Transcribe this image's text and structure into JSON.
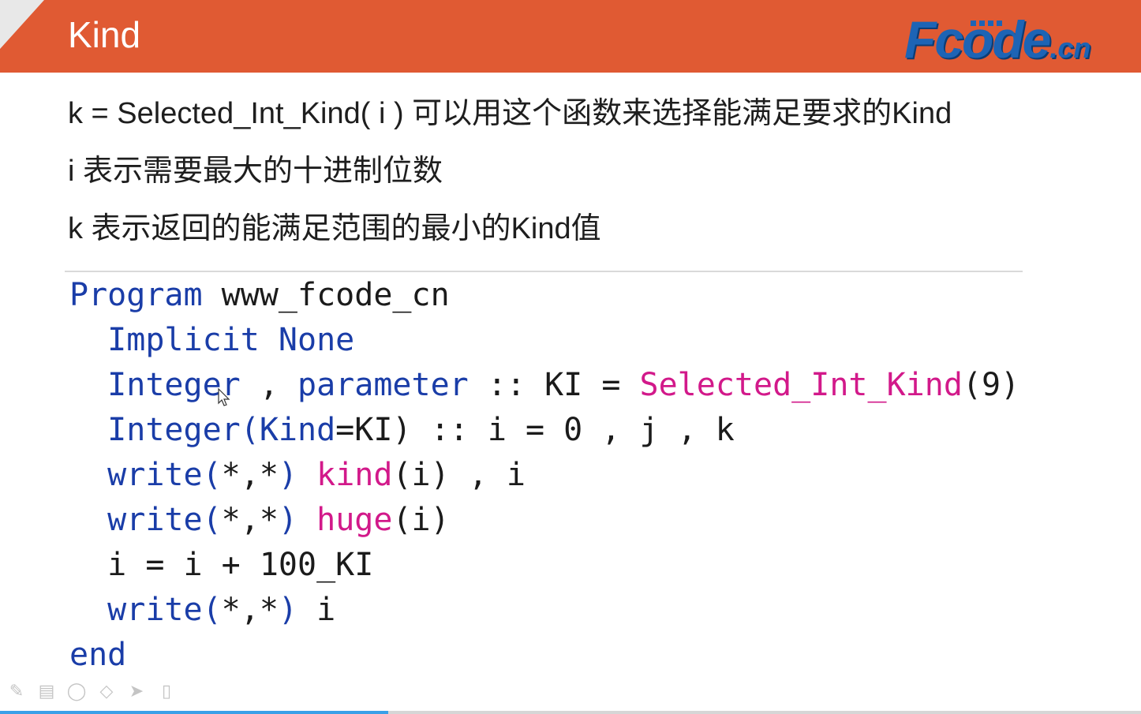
{
  "slide": {
    "title": "Kind",
    "logo": {
      "text_main": "Fcode",
      "text_suffix": ".cn"
    },
    "description": [
      "k = Selected_Int_Kind( i )  可以用这个函数来选择能满足要求的Kind",
      "i 表示需要最大的十进制位数",
      "k 表示返回的能满足范围的最小的Kind值"
    ],
    "code": [
      [
        {
          "t": "Program",
          "c": "kw"
        },
        {
          "t": " www_fcode_cn",
          "c": "punct"
        }
      ],
      [
        {
          "t": "  ",
          "c": "punct"
        },
        {
          "t": "Implicit None",
          "c": "kw"
        }
      ],
      [
        {
          "t": "  ",
          "c": "punct"
        },
        {
          "t": "Integer",
          "c": "kw"
        },
        {
          "t": " , ",
          "c": "punct"
        },
        {
          "t": "parameter",
          "c": "kw"
        },
        {
          "t": " :: KI = ",
          "c": "punct"
        },
        {
          "t": "Selected_Int_Kind",
          "c": "fn"
        },
        {
          "t": "(9)",
          "c": "punct"
        }
      ],
      [
        {
          "t": "  ",
          "c": "punct"
        },
        {
          "t": "Integer(Kind",
          "c": "kw"
        },
        {
          "t": "=KI) :: i = 0 , j , k",
          "c": "punct"
        }
      ],
      [
        {
          "t": "  ",
          "c": "punct"
        },
        {
          "t": "write(",
          "c": "kw"
        },
        {
          "t": "*,*",
          "c": "punct"
        },
        {
          "t": ")",
          "c": "kw"
        },
        {
          "t": " ",
          "c": "punct"
        },
        {
          "t": "kind",
          "c": "fn"
        },
        {
          "t": "(i) , i",
          "c": "punct"
        }
      ],
      [
        {
          "t": "  ",
          "c": "punct"
        },
        {
          "t": "write(",
          "c": "kw"
        },
        {
          "t": "*,*",
          "c": "punct"
        },
        {
          "t": ")",
          "c": "kw"
        },
        {
          "t": " ",
          "c": "punct"
        },
        {
          "t": "huge",
          "c": "fn"
        },
        {
          "t": "(i)",
          "c": "punct"
        }
      ],
      [
        {
          "t": "  i = i + 100_KI",
          "c": "punct"
        }
      ],
      [
        {
          "t": "  ",
          "c": "punct"
        },
        {
          "t": "write(",
          "c": "kw"
        },
        {
          "t": "*,*",
          "c": "punct"
        },
        {
          "t": ")",
          "c": "kw"
        },
        {
          "t": " i",
          "c": "punct"
        }
      ],
      [
        {
          "t": "end",
          "c": "kw"
        }
      ]
    ]
  },
  "player": {
    "tools": [
      {
        "icon": "pen-icon",
        "glyph": "✎"
      },
      {
        "icon": "keyboard-icon",
        "glyph": "▤"
      },
      {
        "icon": "lasso-icon",
        "glyph": "◯"
      },
      {
        "icon": "eraser-icon",
        "glyph": "◇"
      },
      {
        "icon": "pointer-icon",
        "glyph": "➤"
      },
      {
        "icon": "remote-icon",
        "glyph": "▯"
      }
    ],
    "progress": 0.34
  },
  "colors": {
    "header": "#e05a33",
    "keyword": "#1a3da8",
    "function": "#d2198a",
    "logo": "#1d64b5",
    "progress": "#3aa0e8"
  }
}
